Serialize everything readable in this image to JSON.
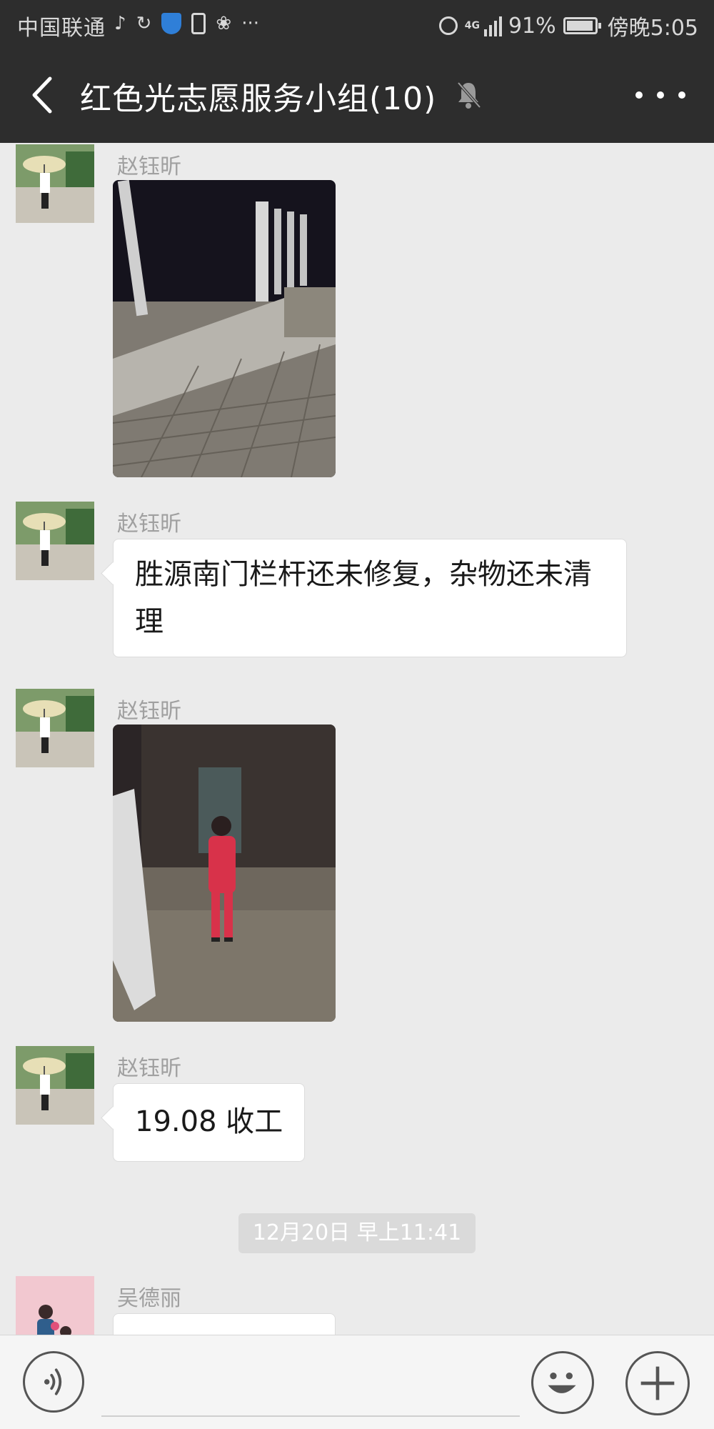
{
  "status_bar": {
    "carrier": "中国联通",
    "network": "4G",
    "battery": "91%",
    "time": "傍晚5:05",
    "extra_icons": [
      "HD-audio-icon",
      "sync-icon",
      "shield-icon",
      "lock-icon",
      "huawei-icon",
      "more-dots-icon"
    ]
  },
  "header": {
    "title": "红色光志愿服务小组(10)",
    "muted": true
  },
  "messages": [
    {
      "sender": "赵钰昕",
      "type": "image",
      "description": "night railing and pavement"
    },
    {
      "sender": "赵钰昕",
      "type": "text",
      "text": "胜源南门栏杆还未修复，杂物还未清理"
    },
    {
      "sender": "赵钰昕",
      "type": "image",
      "description": "person in red standing at night"
    },
    {
      "sender": "赵钰昕",
      "type": "text",
      "text": "19.08 收工"
    },
    {
      "sender": "吴德丽",
      "type": "text",
      "text": ""
    }
  ],
  "timestamp": "12月20日 早上11:41",
  "input_bar": {
    "placeholder": ""
  },
  "colors": {
    "header_bg": "#2d2d2d",
    "chat_bg": "#ebebeb",
    "bubble_bg": "#ffffff"
  }
}
